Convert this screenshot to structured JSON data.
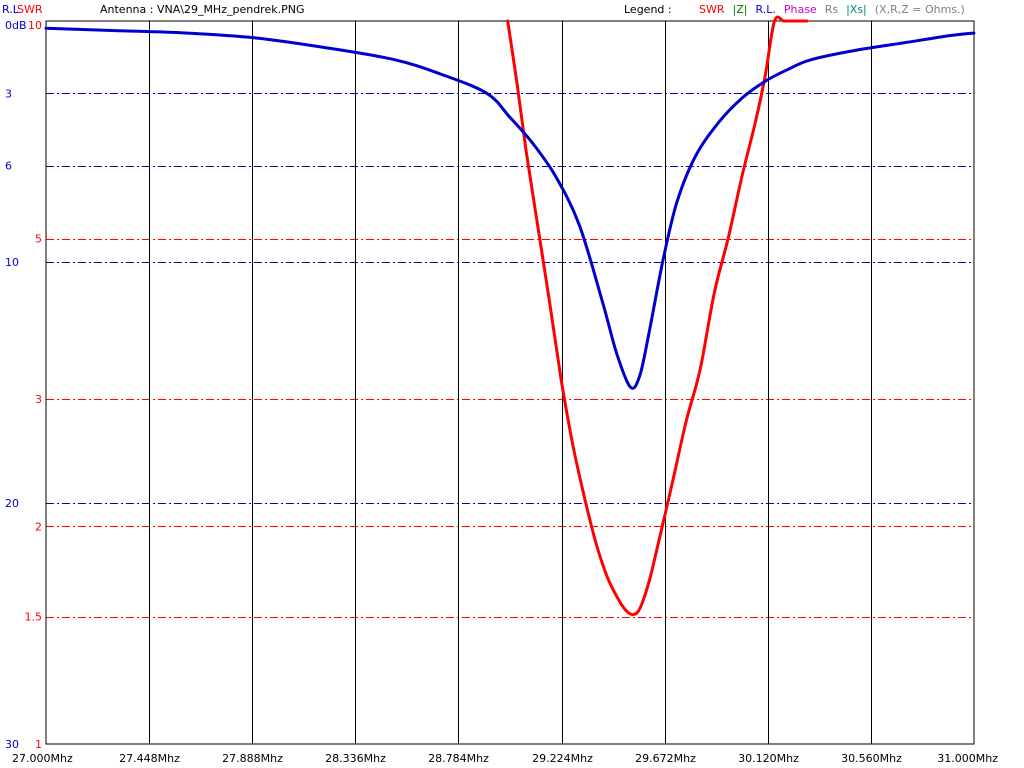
{
  "header": {
    "rl_label": "R.L",
    "swr_label": "SWR",
    "antenna_label": "Antenna : VNA\\29_MHz_pendrek.PNG",
    "legend_label": "Legend :",
    "legend_items": [
      {
        "text": "SWR",
        "color": "#ff0000"
      },
      {
        "text": "|Z|",
        "color": "#008000"
      },
      {
        "text": "R.L.",
        "color": "#0000cc"
      },
      {
        "text": "Phase",
        "color": "#cc00cc"
      },
      {
        "text": "Rs",
        "color": "#808080"
      },
      {
        "text": "|Xs|",
        "color": "#008080"
      },
      {
        "text": "(X,R,Z = Ohms.)",
        "color": "#808080"
      }
    ]
  },
  "colors": {
    "swr": "#ff0000",
    "return_loss": "#0000cc",
    "grid_vertical": "#000000",
    "background": "#ffffff"
  },
  "chart_data": {
    "type": "line",
    "x_unit": "Mhz",
    "xlim": [
      27.0,
      31.0
    ],
    "x_ticks": [
      "27.000Mhz",
      "27.448Mhz",
      "27.888Mhz",
      "28.336Mhz",
      "28.784Mhz",
      "29.224Mhz",
      "29.672Mhz",
      "30.120Mhz",
      "30.560Mhz",
      "31.000Mhz"
    ],
    "y_left_rl": {
      "label": "R.L",
      "ticks": [
        "0dB",
        "3",
        "6",
        "10",
        "20",
        "30"
      ],
      "ylim": [
        0,
        30
      ],
      "gridlines": [
        3,
        6,
        10,
        20
      ]
    },
    "y_left_swr": {
      "label": "SWR",
      "scale": "log",
      "ticks": [
        "10",
        "5",
        "3",
        "2",
        "1.5",
        "1"
      ],
      "ylim": [
        1,
        10
      ],
      "gridlines": [
        5,
        3,
        2,
        1.5
      ]
    },
    "series": [
      {
        "name": "SWR",
        "axis": "swr",
        "x": [
          28.99,
          29.03,
          29.07,
          29.12,
          29.17,
          29.22,
          29.27,
          29.32,
          29.37,
          29.42,
          29.47,
          29.5,
          29.53,
          29.56,
          29.6,
          29.64,
          29.7,
          29.76,
          29.82,
          29.88,
          29.94,
          30.0,
          30.06,
          30.1,
          30.14,
          30.18,
          30.22,
          30.26,
          30.28
        ],
        "values": [
          10.0,
          8.2,
          6.6,
          5.2,
          4.1,
          3.2,
          2.6,
          2.2,
          1.9,
          1.7,
          1.58,
          1.53,
          1.51,
          1.54,
          1.68,
          1.9,
          2.3,
          2.8,
          3.3,
          4.2,
          5.0,
          6.1,
          7.3,
          8.4,
          10.0,
          10.0,
          10.0,
          10.0,
          10.0
        ]
      },
      {
        "name": "R.L.",
        "axis": "rl",
        "x": [
          27.0,
          27.3,
          27.6,
          27.9,
          28.2,
          28.5,
          28.7,
          28.9,
          29.0,
          29.1,
          29.2,
          29.3,
          29.4,
          29.46,
          29.52,
          29.56,
          29.6,
          29.66,
          29.72,
          29.8,
          29.9,
          30.0,
          30.1,
          30.2,
          30.3,
          30.5,
          30.7,
          30.9,
          31.0
        ],
        "values": [
          0.3,
          0.4,
          0.5,
          0.7,
          1.1,
          1.6,
          2.2,
          3.0,
          4.0,
          5.1,
          6.5,
          8.5,
          11.7,
          13.8,
          15.2,
          14.7,
          12.9,
          9.9,
          7.5,
          5.6,
          4.2,
          3.2,
          2.5,
          2.0,
          1.6,
          1.2,
          0.9,
          0.6,
          0.5
        ]
      }
    ]
  }
}
